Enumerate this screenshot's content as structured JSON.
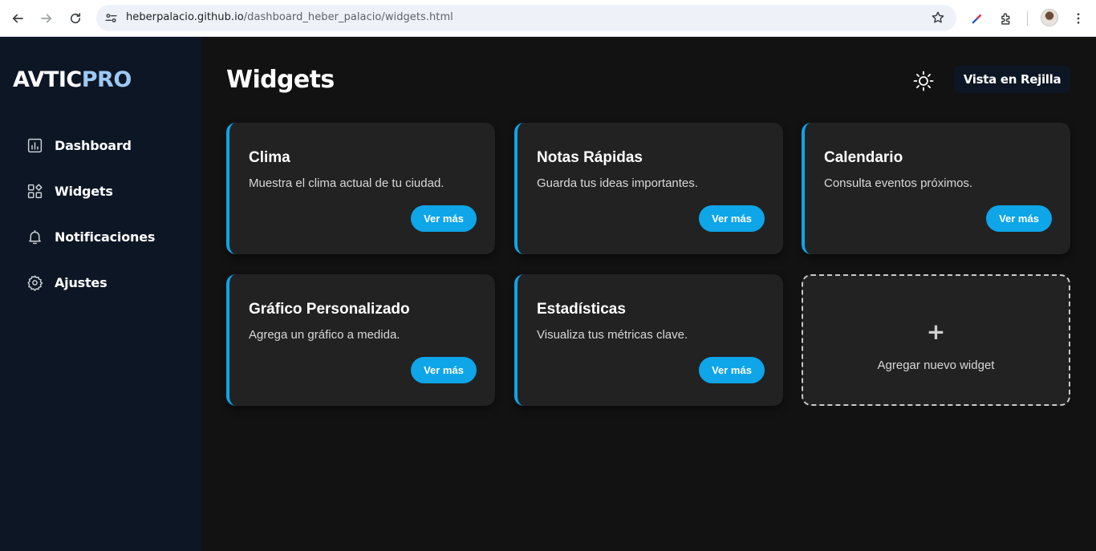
{
  "browser": {
    "url_host": "heberpalacio.github.io",
    "url_path": "/dashboard_heber_palacio/widgets.html",
    "icons": [
      "back-arrow-icon",
      "forward-arrow-icon",
      "reload-icon",
      "site-info-icon",
      "bookmark-star-icon",
      "eyedropper-extension-icon",
      "extensions-puzzle-icon",
      "profile-avatar",
      "more-menu-icon"
    ]
  },
  "sidebar": {
    "logo_part1": "AVTIC",
    "logo_part2": "PRO",
    "items": [
      {
        "label": "Dashboard",
        "icon": "bar-chart-icon"
      },
      {
        "label": "Widgets",
        "icon": "widgets-grid-icon"
      },
      {
        "label": "Notificaciones",
        "icon": "bell-icon"
      },
      {
        "label": "Ajustes",
        "icon": "gear-icon"
      }
    ]
  },
  "main": {
    "title": "Widgets",
    "theme_icon": "sun-icon",
    "view_button": "Vista en Rejilla",
    "cards": [
      {
        "title": "Clima",
        "description": "Muestra el clima actual de tu ciudad.",
        "button": "Ver más"
      },
      {
        "title": "Notas Rápidas",
        "description": "Guarda tus ideas importantes.",
        "button": "Ver más"
      },
      {
        "title": "Calendario",
        "description": "Consulta eventos próximos.",
        "button": "Ver más"
      },
      {
        "title": "Gráfico Personalizado",
        "description": "Agrega un gráfico a medida.",
        "button": "Ver más"
      },
      {
        "title": "Estadísticas",
        "description": "Visualiza tus métricas clave.",
        "button": "Ver más"
      }
    ],
    "add_widget": {
      "symbol": "+",
      "label": "Agregar nuevo widget"
    }
  },
  "colors": {
    "accent": "#0ea5e9",
    "sidebar_bg": "#0d1624",
    "main_bg": "#121212",
    "card_bg": "#222222",
    "logo_accent": "#9cc9f3"
  }
}
